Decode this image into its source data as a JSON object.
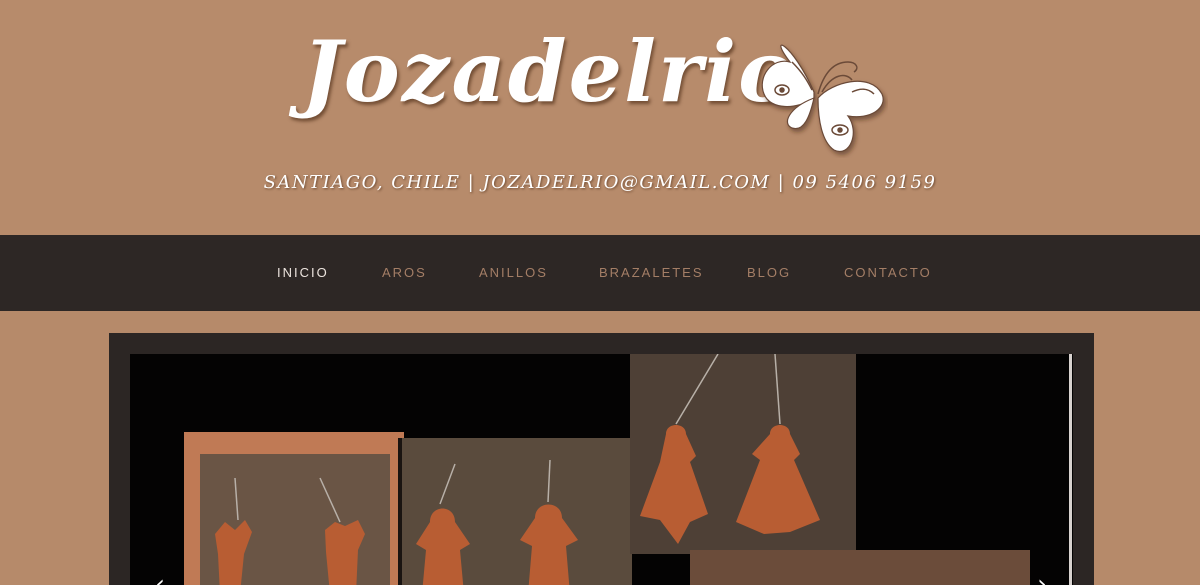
{
  "header": {
    "site_title": "Jozadelrio",
    "contact_line": "SANTIAGO, CHILE | JOZADELRIO@GMAIL.COM | 09 5406 9159",
    "logo_icon": "butterfly-icon"
  },
  "nav": {
    "items": [
      {
        "label": "INICIO",
        "active": true
      },
      {
        "label": "AROS",
        "active": false
      },
      {
        "label": "ANILLOS",
        "active": false
      },
      {
        "label": "BRAZALETES",
        "active": false
      },
      {
        "label": "BLOG",
        "active": false
      },
      {
        "label": "CONTACTO",
        "active": false
      }
    ]
  },
  "slider": {
    "prev_icon": "chevron-left-icon",
    "next_icon": "chevron-right-icon",
    "prev_glyph": "‹",
    "next_glyph": "›"
  },
  "colors": {
    "background": "#b68a6a",
    "nav_background": "#2d2725",
    "nav_text": "#a47e66",
    "nav_active": "#ece4de"
  }
}
